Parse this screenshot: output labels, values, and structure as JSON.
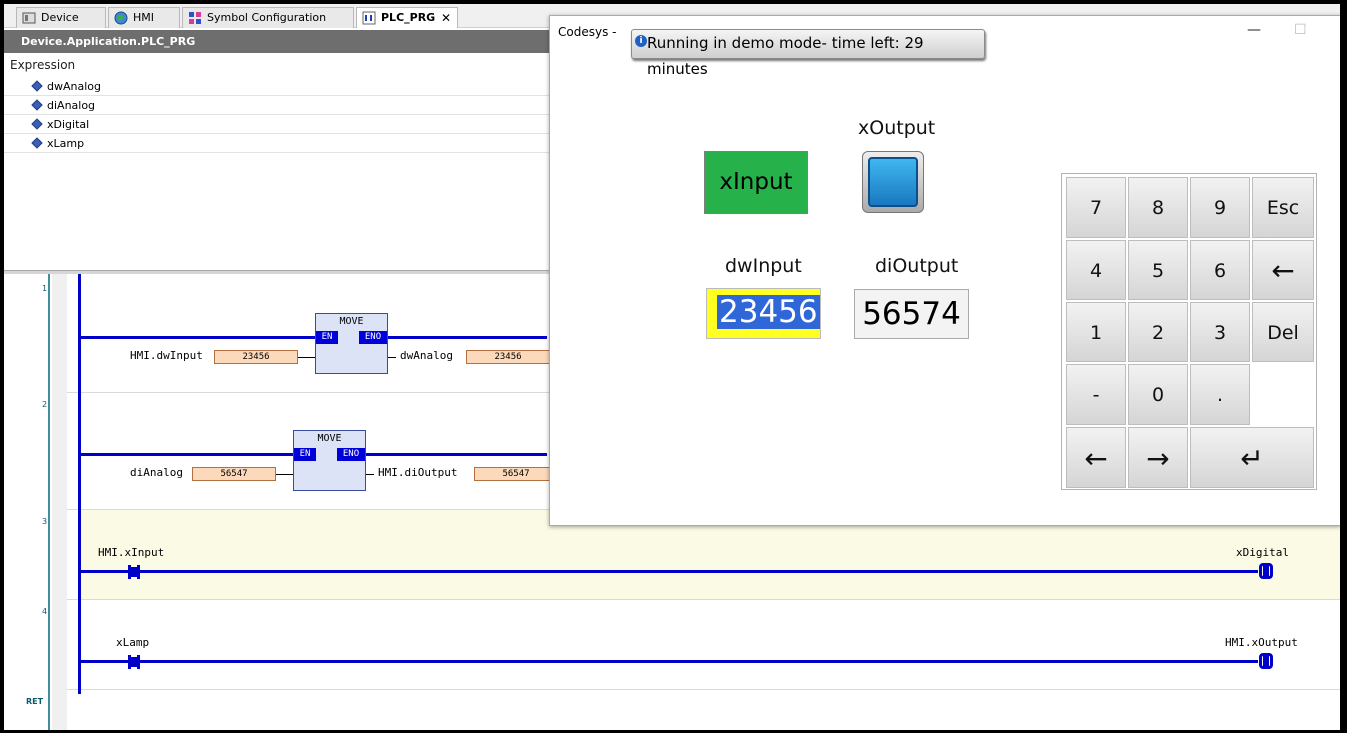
{
  "tabs": [
    {
      "label": "Device",
      "icon": "device-icon"
    },
    {
      "label": "HMI",
      "icon": "globe-icon"
    },
    {
      "label": "Symbol Configuration",
      "icon": "symbol-icon"
    },
    {
      "label": "PLC_PRG",
      "icon": "pou-icon",
      "close": "✕"
    }
  ],
  "editor": {
    "title": "Device.Application.PLC_PRG"
  },
  "watch": {
    "header": "Expression",
    "rows": [
      "dwAnalog",
      "diAnalog",
      "xDigital",
      "xLamp"
    ]
  },
  "ladder": {
    "rung_numbers": [
      "1",
      "2",
      "3",
      "4",
      "RET"
    ],
    "rung1": {
      "block": "MOVE",
      "en": "EN",
      "eno": "ENO",
      "in_var": "HMI.dwInput",
      "in_val": "23456",
      "out_var": "dwAnalog",
      "out_val": "23456"
    },
    "rung2": {
      "block": "MOVE",
      "en": "EN",
      "eno": "ENO",
      "in_var": "diAnalog",
      "in_val": "56547",
      "out_var": "HMI.diOutput",
      "out_val": "56547"
    },
    "rung3": {
      "contact": "HMI.xInput",
      "coil": "xDigital"
    },
    "rung4": {
      "contact": "xLamp",
      "coil": "HMI.xOutput"
    }
  },
  "hmi": {
    "title": "Codesys -",
    "minimize": "—",
    "maximize": "☐",
    "demo_banner": "Running in demo mode- time left: 29 minutes",
    "xoutput_label": "xOutput",
    "xinput_button": "xInput",
    "dwinput_label": "dwInput",
    "dwinput_value": "23456",
    "dioutput_label": "diOutput",
    "dioutput_value": "56574",
    "keypad": [
      "7",
      "8",
      "9",
      "Esc",
      "4",
      "5",
      "6",
      "←",
      "1",
      "2",
      "3",
      "Del",
      "-",
      "0",
      ".",
      "←",
      "→",
      "↵"
    ],
    "colors": {
      "xinput_bg": "#27b14b",
      "lamp_on": "#1a78c0",
      "input_bg": "#ffff22"
    }
  }
}
